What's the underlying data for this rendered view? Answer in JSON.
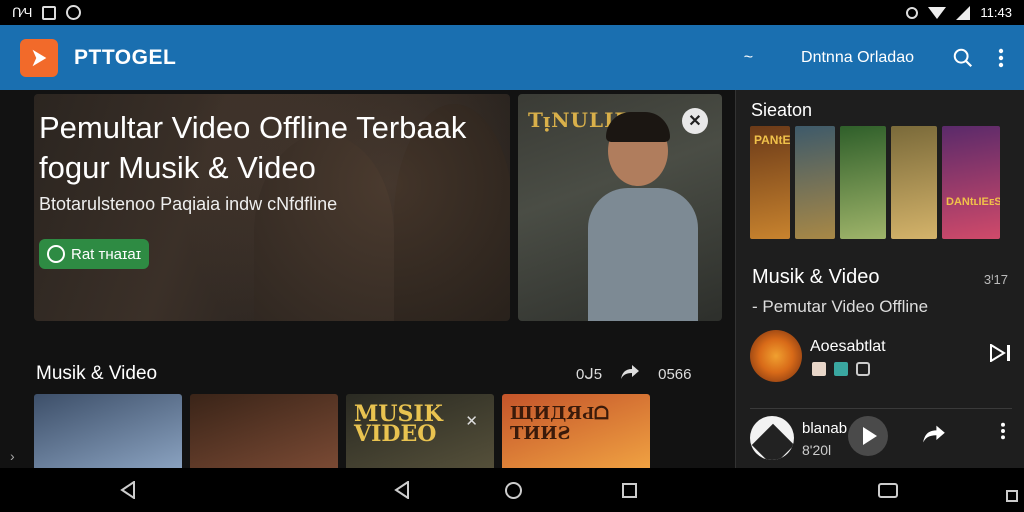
{
  "status_bar": {
    "left_text": "ᑎ⁄Ч",
    "right_text": "11:43"
  },
  "app_bar": {
    "title": "PTTOGEL",
    "tilde": "~",
    "action_text": "Dntnna Orladao",
    "icons": [
      "search-icon",
      "more-vert-icon"
    ]
  },
  "hero": {
    "title_line1": "Pemultar Video Offline Terbaak",
    "title_line2": "fogur Musik & Video",
    "subtitle": "Btotarulstenoo Paqiaia  indw cNfdfline",
    "cta_label": "Rat ᴛʜaɪaɪ"
  },
  "poster": {
    "title": "TᴉNULIEA"
  },
  "section": {
    "title": "Musik & Video",
    "count": "0ᒍ5",
    "count2": "0566",
    "thumbs": [
      {
        "label": "",
        "colors": [
          "#3d4f69",
          "#8aa2c0"
        ]
      },
      {
        "label": "",
        "colors": [
          "#3a2418",
          "#7a4a34"
        ]
      },
      {
        "label": "MUSIK VIDEO",
        "colors": [
          "#2a2a22",
          "#55503a"
        ]
      },
      {
        "label": "ЩИДЯԀᗝ ΤИИƧ",
        "colors": [
          "#c4542a",
          "#f0a242"
        ]
      }
    ]
  },
  "panel": {
    "heading": "Sieaton",
    "mini_posters": [
      {
        "label": "PANtEIE",
        "colors": [
          "#6b3a18",
          "#c8832e"
        ]
      },
      {
        "label": "",
        "colors": [
          "#3e5a6a",
          "#a88846"
        ]
      },
      {
        "label": "",
        "colors": [
          "#2f5f2a",
          "#9fb46a"
        ]
      },
      {
        "label": "",
        "colors": [
          "#7a6a3a",
          "#d4b36a"
        ]
      },
      {
        "label": "DANtʟIEᴇS",
        "colors": [
          "#5a2a6a",
          "#d04a6a"
        ]
      }
    ],
    "title": "Musik & Video",
    "count": "3ᑊ17",
    "subtitle": "- Pemutar Video Offline",
    "track_name": "Aoesabtlat",
    "player_name": "blanab",
    "player_time": "8'20l"
  },
  "accent": "#1a6fb0",
  "brand_orange": "#f26a2a",
  "cta_green": "#2e8b43"
}
